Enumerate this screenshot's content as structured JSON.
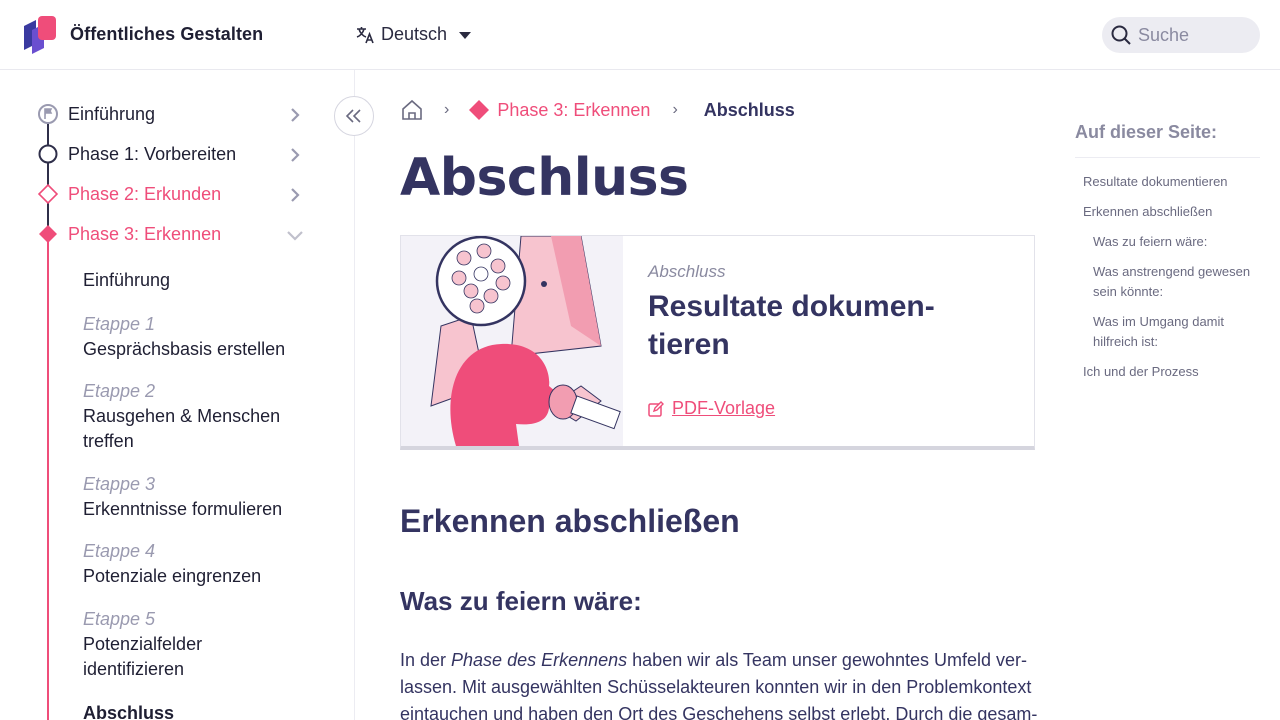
{
  "header": {
    "brand": "Öffentliches Gestalten",
    "language": "Deutsch",
    "search_placeholder": "Suche"
  },
  "sidebar": {
    "phases": [
      {
        "label": "Einführung"
      },
      {
        "label": "Phase 1: Vorbereiten"
      },
      {
        "label": "Phase 2: Erkunden"
      },
      {
        "label": "Phase 3: Erkennen"
      }
    ],
    "subitems": [
      {
        "etappe": "",
        "label": "Einführung"
      },
      {
        "etappe": "Etappe 1",
        "label": "Gesprächsbasis erstellen"
      },
      {
        "etappe": "Etappe 2",
        "label": "Rausgehen & Menschen treffen"
      },
      {
        "etappe": "Etappe 3",
        "label": "Erkenntnisse formulieren"
      },
      {
        "etappe": "Etappe 4",
        "label": "Potenziale eingrenzen"
      },
      {
        "etappe": "Etappe 5",
        "label": "Potenzialfelder identifizieren"
      },
      {
        "etappe": "",
        "label": "Abschluss"
      }
    ]
  },
  "breadcrumb": {
    "phase": "Phase 3: Erkennen",
    "current": "Abschluss"
  },
  "main": {
    "title": "Abschluss",
    "card": {
      "kicker": "Abschluss",
      "title": "Resultate dokumen-tieren",
      "link": "PDF-Vorlage"
    },
    "h2": "Erkennen abschließen",
    "h3": "Was zu feiern wäre:",
    "para_before": "In der ",
    "para_em": "Phase des Erkennens",
    "para_after": " haben wir als Team unser gewohntes Umfeld ver-lassen. Mit ausgewählten Schüsselakteuren konnten wir in den Problemkontext eintauchen und haben den Ort des Geschehens selbst erlebt. Durch die gesam-"
  },
  "toc": {
    "title": "Auf dieser Seite:",
    "items": [
      "Resultate dokumentieren",
      "Erkennen abschließen",
      "Was zu feiern wäre:",
      "Was anstrengend gewesen sein könnte:",
      "Was im Umgang damit hilfreich ist:",
      "Ich und der Prozess"
    ]
  },
  "colors": {
    "accent": "#ef4d7a",
    "navy": "#343461",
    "muted": "#8a8aa0"
  }
}
